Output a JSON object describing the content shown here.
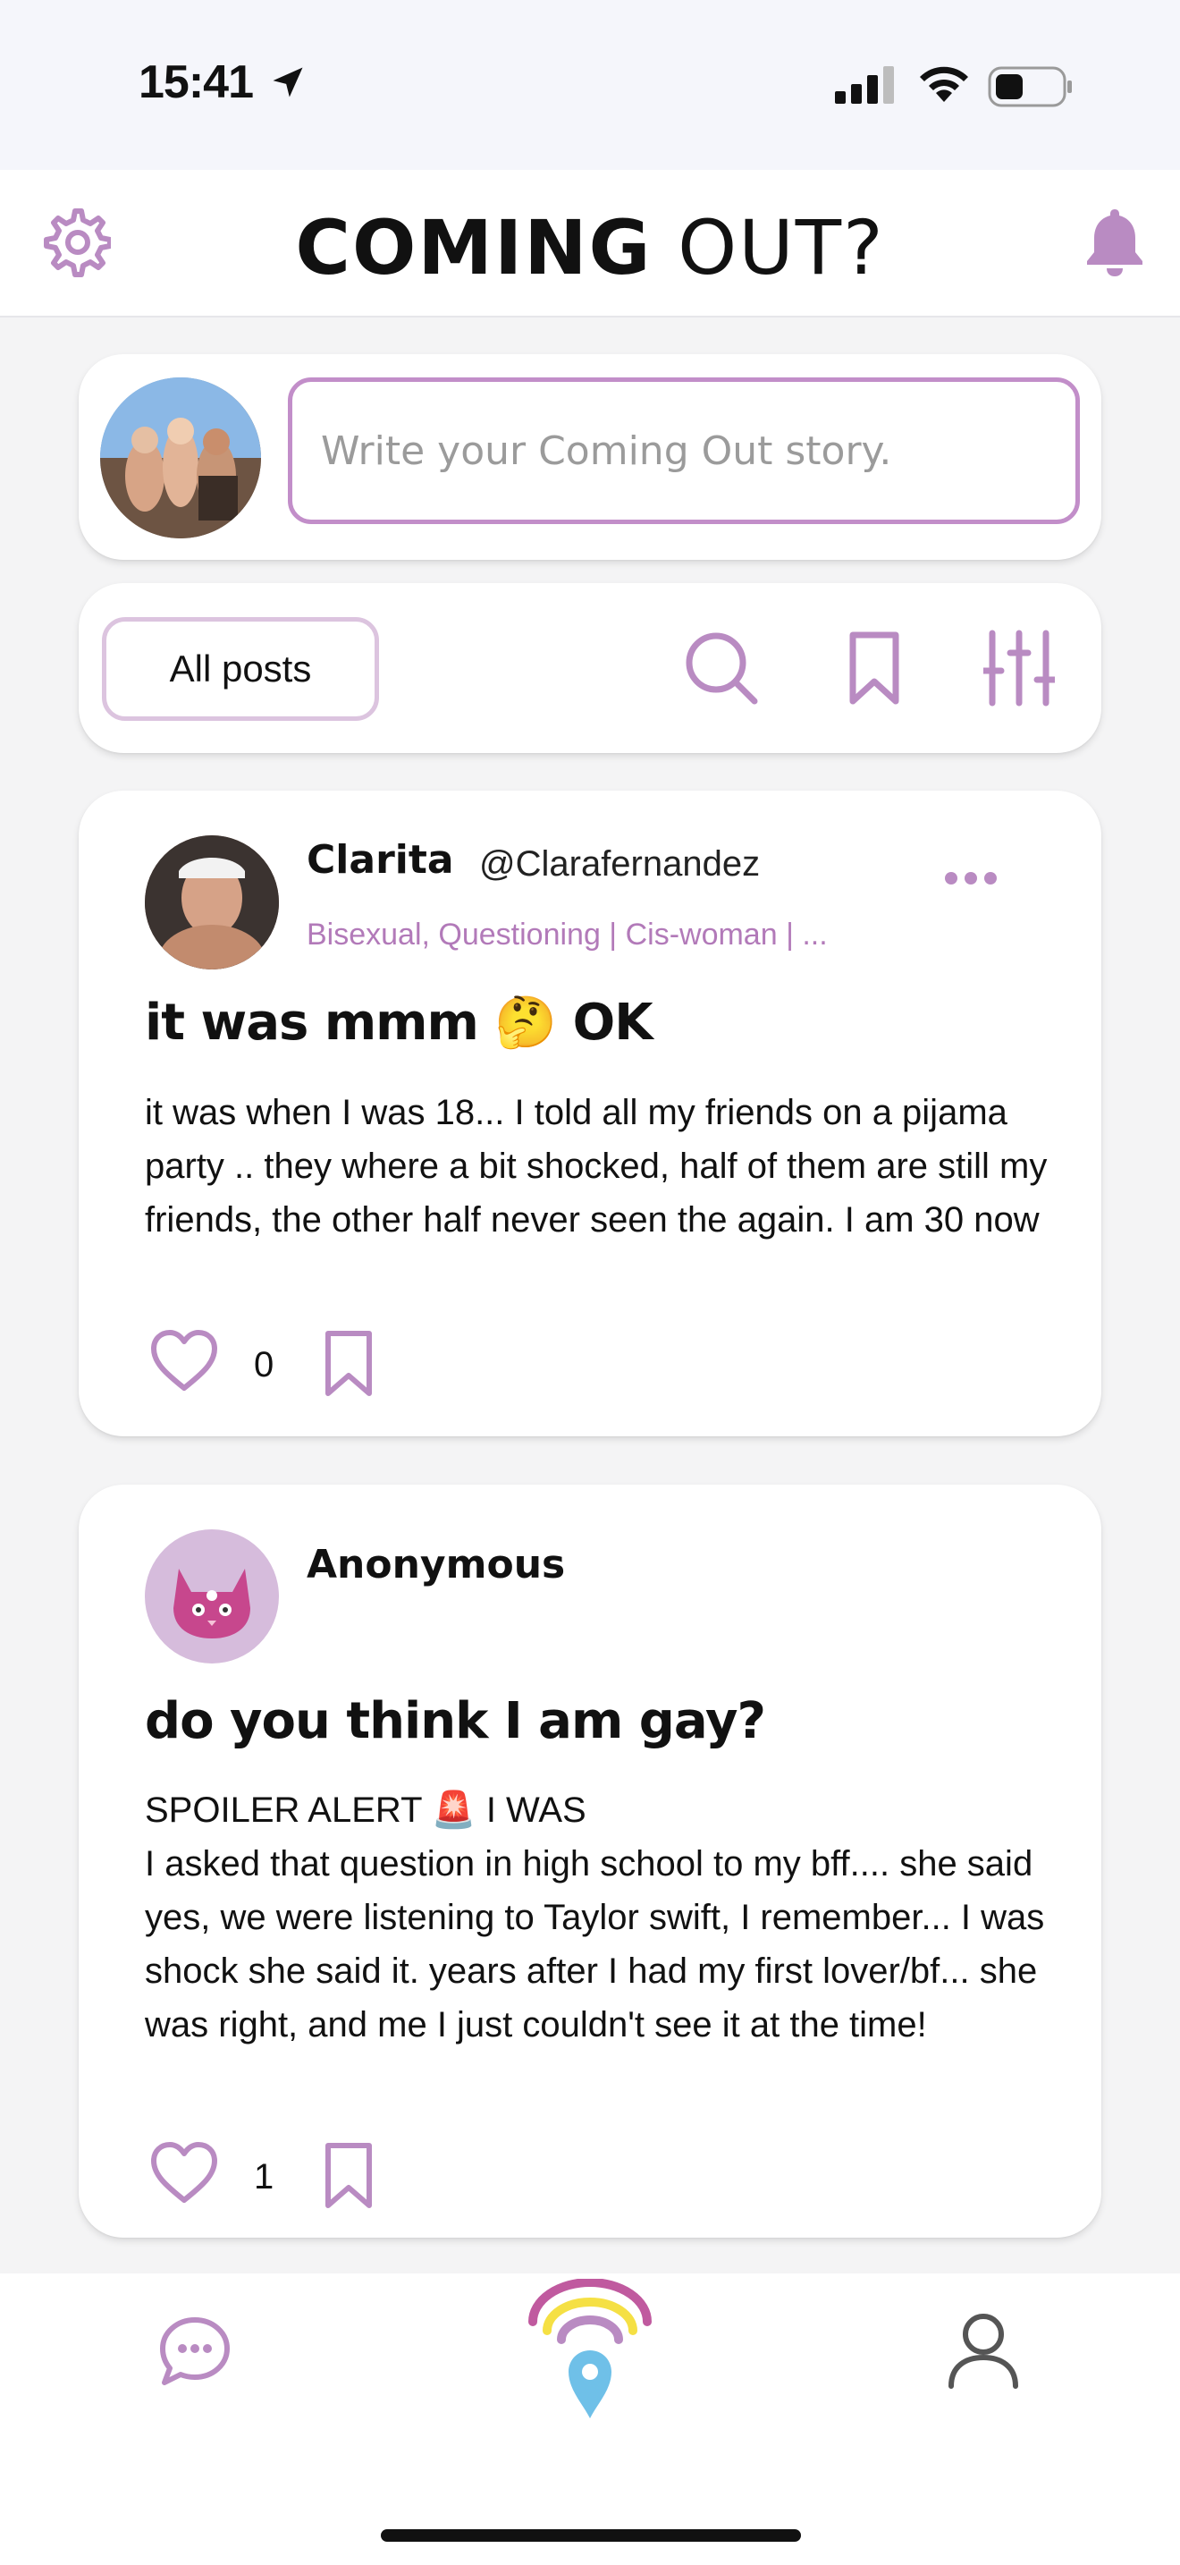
{
  "status_bar": {
    "time": "15:41"
  },
  "header": {
    "logo_part1": "COMING",
    "logo_part2": "OUT?"
  },
  "composer": {
    "placeholder": "Write your Coming Out story."
  },
  "filters": {
    "all_posts_label": "All posts"
  },
  "posts": [
    {
      "author": "Clarita",
      "handle": "@Clarafernandez",
      "tags": "Bisexual, Questioning | Cis-woman | ...",
      "title": "it was mmm 🤔 OK",
      "body": "it was when I was 18... I told all my friends on a pijama party .. they where a bit shocked, half of them are still my friends, the other half never seen the again. I am 30 now",
      "likes": "0"
    },
    {
      "author": "Anonymous",
      "title": "do you think I am gay?",
      "body": "SPOILER ALERT 🚨 I WAS\nI asked that question in high school to my bff.... she said yes, we were listening to Taylor swift, I remember... I was shock she said it. years after I had my first lover/bf... she was right, and me I just couldn't see it at the time!",
      "likes": "1"
    }
  ],
  "colors": {
    "accent_purple": "#b98bc2",
    "brand_pink": "#c05a9f",
    "brand_yellow": "#f5e044",
    "brand_blue": "#6fc0e8"
  },
  "icons": {
    "settings": "gear-icon",
    "notifications": "bell-icon",
    "search": "search-icon",
    "bookmark": "bookmark-icon",
    "filter": "sliders-icon",
    "more": "more-dots-icon",
    "like": "heart-icon",
    "chat": "chat-bubble-icon",
    "home": "rainbow-location-icon",
    "profile": "user-icon"
  }
}
